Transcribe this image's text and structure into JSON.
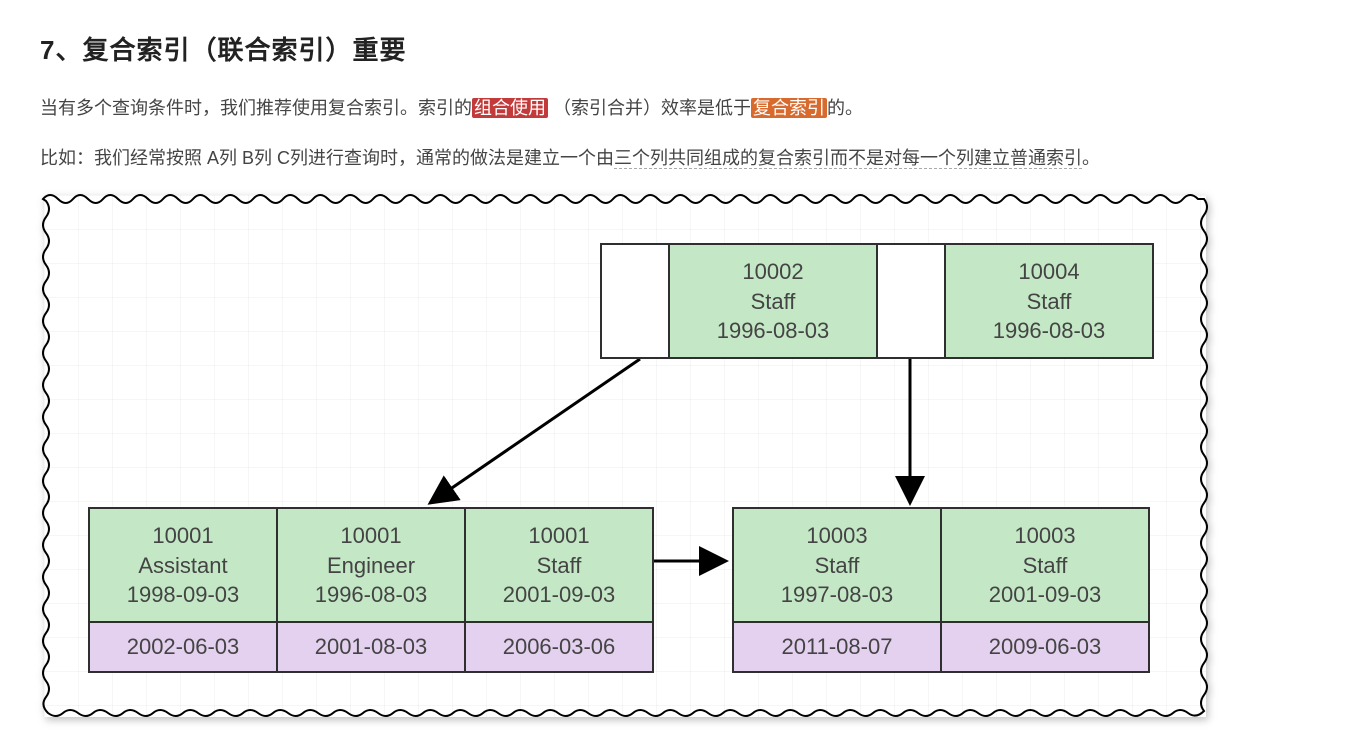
{
  "heading": "7、复合索引（联合索引）重要",
  "para1_a": "当有多个查询条件时，我们推荐使用复合索引。索引的",
  "para1_hl1": "组合使用",
  "para1_b": "（索引合并）效率是低于",
  "para1_hl2": "复合索引",
  "para1_c": "的。",
  "para2_a": "比如：我们经常按照 A列 B列 C列进行查询时，通常的做法是建立一个由",
  "para2_u": "三个列共同组成的复合索引而不是对每一个列建立普通索引",
  "para2_b": "。",
  "root": {
    "blank": "",
    "c1_id": "10002",
    "c1_role": "Staff",
    "c1_date": "1996-08-03",
    "c2_id": "10004",
    "c2_role": "Staff",
    "c2_date": "1996-08-03"
  },
  "leaf_left": [
    {
      "id": "10001",
      "role": "Assistant",
      "date": "1998-09-03",
      "extra": "2002-06-03"
    },
    {
      "id": "10001",
      "role": "Engineer",
      "date": "1996-08-03",
      "extra": "2001-08-03"
    },
    {
      "id": "10001",
      "role": "Staff",
      "date": "2001-09-03",
      "extra": "2006-03-06"
    }
  ],
  "leaf_right": [
    {
      "id": "10003",
      "role": "Staff",
      "date": "1997-08-03",
      "extra": "2011-08-07"
    },
    {
      "id": "10003",
      "role": "Staff",
      "date": "2001-09-03",
      "extra": "2009-06-03"
    }
  ],
  "chart_data": {
    "type": "tree",
    "description": "B+ tree composite index illustration",
    "root_keys": [
      {
        "emp_no": 10002,
        "title": "Staff",
        "from_date": "1996-08-03"
      },
      {
        "emp_no": 10004,
        "title": "Staff",
        "from_date": "1996-08-03"
      }
    ],
    "leaves": [
      {
        "entries": [
          {
            "emp_no": 10001,
            "title": "Assistant",
            "from_date": "1998-09-03",
            "to_date": "2002-06-03"
          },
          {
            "emp_no": 10001,
            "title": "Engineer",
            "from_date": "1996-08-03",
            "to_date": "2001-08-03"
          },
          {
            "emp_no": 10001,
            "title": "Staff",
            "from_date": "2001-09-03",
            "to_date": "2006-03-06"
          }
        ]
      },
      {
        "entries": [
          {
            "emp_no": 10003,
            "title": "Staff",
            "from_date": "1997-08-03",
            "to_date": "2011-08-07"
          },
          {
            "emp_no": 10003,
            "title": "Staff",
            "from_date": "2001-09-03",
            "to_date": "2009-06-03"
          }
        ]
      }
    ],
    "edges": [
      {
        "from": "root.pointer0",
        "to": "leaf0"
      },
      {
        "from": "root.pointer1",
        "to": "leaf1"
      },
      {
        "from": "leaf0",
        "to": "leaf1",
        "kind": "sibling"
      }
    ]
  }
}
